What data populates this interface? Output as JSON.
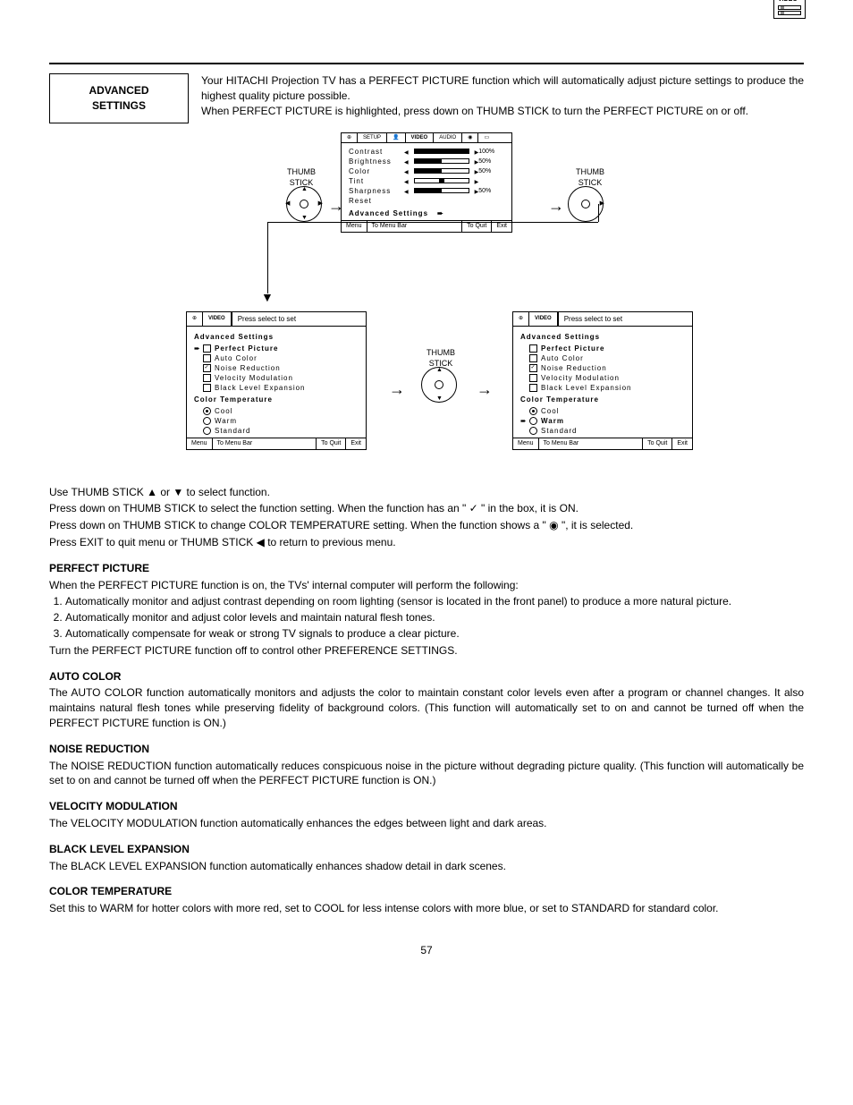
{
  "corner_label": "VIDEO",
  "section_title_1": "ADVANCED",
  "section_title_2": "SETTINGS",
  "intro_para_1": "Your HITACHI Projection TV has a PERFECT PICTURE function which will automatically adjust picture settings to produce the highest quality picture possible.",
  "intro_para_2": "When PERFECT PICTURE is highlighted, press down on THUMB STICK to turn the PERFECT PICTURE on or off.",
  "thumbstick_label": "THUMB STICK",
  "osd_main": {
    "tabs": [
      "SETUP",
      "",
      "VIDEO",
      "AUDIO",
      "",
      ""
    ],
    "rows": [
      {
        "name": "Contrast",
        "pct": "100%",
        "fill": 100
      },
      {
        "name": "Brightness",
        "pct": "50%",
        "fill": 50
      },
      {
        "name": "Color",
        "pct": "50%",
        "fill": 50
      },
      {
        "name": "Tint",
        "pct": "",
        "fill": 50,
        "center": true
      },
      {
        "name": "Sharpness",
        "pct": "50%",
        "fill": 50
      }
    ],
    "reset": "Reset",
    "advanced": "Advanced Settings",
    "footer": {
      "menu": "Menu",
      "menubar": "To Menu Bar",
      "toquit": "To Quit",
      "exit": "Exit"
    }
  },
  "osd_left": {
    "tab": "VIDEO",
    "press": "Press select to set",
    "heading": "Advanced Settings",
    "items": [
      {
        "ptr": "➨",
        "box": "",
        "label": "Perfect Picture",
        "bold": true
      },
      {
        "ptr": "",
        "box": "",
        "label": "Auto Color"
      },
      {
        "ptr": "",
        "box": "✓",
        "label": "Noise Reduction"
      },
      {
        "ptr": "",
        "box": "",
        "label": "Velocity Modulation"
      },
      {
        "ptr": "",
        "box": "",
        "label": "Black Level Expansion"
      }
    ],
    "ct_heading": "Color Temperature",
    "ct": [
      {
        "ptr": "",
        "sel": true,
        "label": "Cool"
      },
      {
        "ptr": "",
        "sel": false,
        "label": "Warm"
      },
      {
        "ptr": "",
        "sel": false,
        "label": "Standard"
      }
    ],
    "footer": {
      "menu": "Menu",
      "menubar": "To Menu Bar",
      "toquit": "To Quit",
      "exit": "Exit"
    }
  },
  "osd_right": {
    "tab": "VIDEO",
    "press": "Press select to set",
    "heading": "Advanced Settings",
    "items": [
      {
        "ptr": "",
        "box": "",
        "label": "Perfect Picture",
        "bold": true
      },
      {
        "ptr": "",
        "box": "",
        "label": "Auto Color"
      },
      {
        "ptr": "",
        "box": "✓",
        "label": "Noise Reduction"
      },
      {
        "ptr": "",
        "box": "",
        "label": "Velocity Modulation"
      },
      {
        "ptr": "",
        "box": "",
        "label": "Black Level Expansion"
      }
    ],
    "ct_heading": "Color Temperature",
    "ct": [
      {
        "ptr": "",
        "sel": true,
        "label": "Cool"
      },
      {
        "ptr": "➨",
        "sel": false,
        "label": "Warm",
        "bold": true
      },
      {
        "ptr": "",
        "sel": false,
        "label": "Standard"
      }
    ],
    "footer": {
      "menu": "Menu",
      "menubar": "To Menu Bar",
      "toquit": "To Quit",
      "exit": "Exit"
    }
  },
  "instructions": {
    "line1_a": "Use THUMB STICK ▲ or ▼ to select function.",
    "line2": "Press down on THUMB STICK to select the function setting. When the function has an \" ✓ \" in the box, it is ON.",
    "line3": "Press down on THUMB STICK to change COLOR TEMPERATURE setting.  When the function shows a \" ◉ \", it is selected.",
    "line4": "Press EXIT to quit menu or THUMB STICK ◀ to return to previous menu."
  },
  "perfect_picture": {
    "h": "PERFECT PICTURE",
    "p": "When the PERFECT PICTURE function is on, the TVs' internal computer will perform the following:",
    "li1": "Automatically monitor and adjust contrast depending on room lighting (sensor is located in the front panel) to produce a more natural picture.",
    "li2": "Automatically monitor and adjust color levels and maintain natural flesh tones.",
    "li3": "Automatically compensate for weak or strong TV signals to produce a clear picture.",
    "p2": "Turn the PERFECT PICTURE function off to control other PREFERENCE SETTINGS."
  },
  "auto_color": {
    "h": "AUTO COLOR",
    "p": "The AUTO COLOR function automatically monitors and adjusts the color to maintain constant color levels even after a program or channel changes. It also maintains natural flesh tones while preserving fidelity of background colors. (This function will automatically set to on and cannot be turned off when the PERFECT PICTURE function is ON.)"
  },
  "noise_reduction": {
    "h": "NOISE REDUCTION",
    "p": "The NOISE REDUCTION function automatically reduces conspicuous noise in the picture without degrading picture quality. (This function will automatically be set to on and cannot be turned off when the PERFECT PICTURE function is ON.)"
  },
  "velocity_modulation": {
    "h": "VELOCITY MODULATION",
    "p": "The VELOCITY MODULATION function automatically enhances the edges between light and dark areas."
  },
  "black_level": {
    "h": "BLACK LEVEL EXPANSION",
    "p": "The BLACK LEVEL EXPANSION function automatically enhances shadow detail in dark scenes."
  },
  "color_temperature": {
    "h": "COLOR TEMPERATURE",
    "p": "Set this to WARM for hotter colors with more red, set to COOL for less intense colors with more blue, or set to STANDARD for standard color."
  },
  "page_number": "57"
}
